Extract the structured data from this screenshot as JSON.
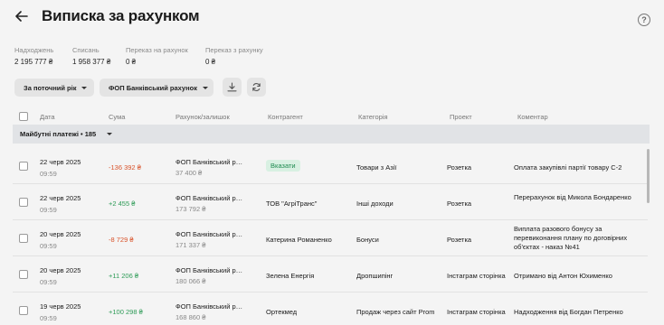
{
  "header": {
    "title": "Виписка за рахунком",
    "help": "?"
  },
  "stats": [
    {
      "label": "Надходжень",
      "value": "2 195 777 ₴"
    },
    {
      "label": "Списань",
      "value": "1 958 377 ₴"
    },
    {
      "label": "Переказ на рахунок",
      "value": "0 ₴"
    },
    {
      "label": "Переказ з рахунку",
      "value": "0 ₴"
    }
  ],
  "filters": {
    "period": "За поточний рік",
    "account": "ФОП Банківський рахунок"
  },
  "columns": [
    "Дата",
    "Сума",
    "Рахунок/залишок",
    "Контрагент",
    "Категорія",
    "Проект",
    "Коментар"
  ],
  "group": {
    "label": "Майбутні платежі • 185"
  },
  "rows": [
    {
      "date": "22 черв 2025",
      "time": "09:59",
      "amount": "-136 392 ₴",
      "sign": "neg",
      "account": "ФОП Банківський рахунок",
      "balance": "37 400 ₴",
      "counterparty": "",
      "badge": "Вказати",
      "category": "Товари з Азії",
      "project": "Розетка",
      "comment": "Оплата закупівлі партії товару С-2"
    },
    {
      "date": "22 черв 2025",
      "time": "09:59",
      "amount": "+2 455 ₴",
      "sign": "pos",
      "account": "ФОП Банківський рахунок",
      "balance": "173 792 ₴",
      "counterparty": "ТОВ \"АгріТранс\"",
      "badge": "",
      "category": "Інші доходи",
      "project": "Розетка",
      "comment": "Перерахунок від Микола Бондаренко"
    },
    {
      "date": "20 черв 2025",
      "time": "09:59",
      "amount": "-8 729 ₴",
      "sign": "neg",
      "account": "ФОП Банківський рахунок",
      "balance": "171 337 ₴",
      "counterparty": "Катерина Романенко",
      "badge": "",
      "category": "Бонуси",
      "project": "Розетка",
      "comment": "Виплата разового бонусу за перевиконання плану по договірних об'єктах - наказ №41"
    },
    {
      "date": "20 черв 2025",
      "time": "09:59",
      "amount": "+11 206 ₴",
      "sign": "pos",
      "account": "ФОП Банківський рахунок",
      "balance": "180 066 ₴",
      "counterparty": "Зелена Енергія",
      "badge": "",
      "category": "Дропшипінг",
      "project": "Інстаграм сторінка",
      "comment": "Отримано від Антон Юхименко"
    },
    {
      "date": "19 черв 2025",
      "time": "09:59",
      "amount": "+100 298 ₴",
      "sign": "pos",
      "account": "ФОП Банківський рахунок",
      "balance": "168 860 ₴",
      "counterparty": "Ортекмед",
      "badge": "",
      "category": "Продаж через сайт Prom",
      "project": "Інстаграм сторінка",
      "comment": "Надходження від Богдан Петренко"
    }
  ]
}
